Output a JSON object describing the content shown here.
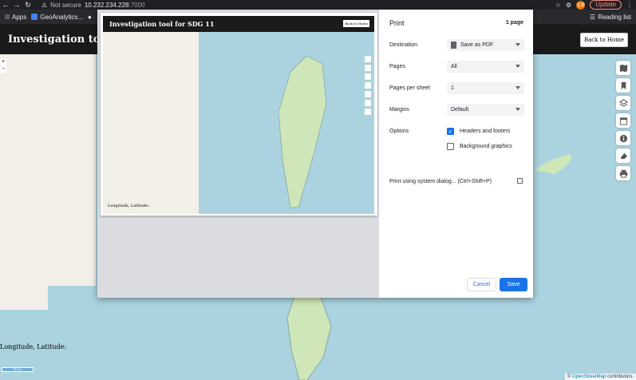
{
  "browser": {
    "security_label": "Not secure",
    "host": "10.232.234.228",
    "port": ":7000",
    "update_label": "Update",
    "avatar_text": "主要",
    "bookmarks": [
      "Apps",
      "GeoAnalytics..."
    ],
    "reading_list": "Reading list"
  },
  "app": {
    "title": "Investigation tool for SDG 11",
    "back_home": "Back to Home",
    "coords_label": "Longitude, Latitude:",
    "scale_label": "50 km",
    "attribution_prefix": "©",
    "attribution_link": "OpenStreetMap",
    "attribution_suffix": "contributors.",
    "tools": [
      "map-icon",
      "bookmark-icon",
      "layers-icon",
      "calendar-icon",
      "info-icon",
      "eraser-icon",
      "print-icon"
    ]
  },
  "print_dialog": {
    "title": "Print",
    "page_count": "1 page",
    "destination_label": "Destination",
    "destination_value": "Save as PDF",
    "pages_label": "Pages",
    "pages_value": "All",
    "pps_label": "Pages per sheet",
    "pps_value": "1",
    "margins_label": "Margins",
    "margins_value": "Default",
    "options_label": "Options",
    "headers_footers": "Headers and footers",
    "headers_footers_checked": true,
    "background_graphics": "Background graphics",
    "background_graphics_checked": false,
    "system_dialog": "Print using system dialog... (Ctrl+Shift+P)",
    "cancel": "Cancel",
    "save": "Save",
    "accent": "#1a73e8"
  }
}
